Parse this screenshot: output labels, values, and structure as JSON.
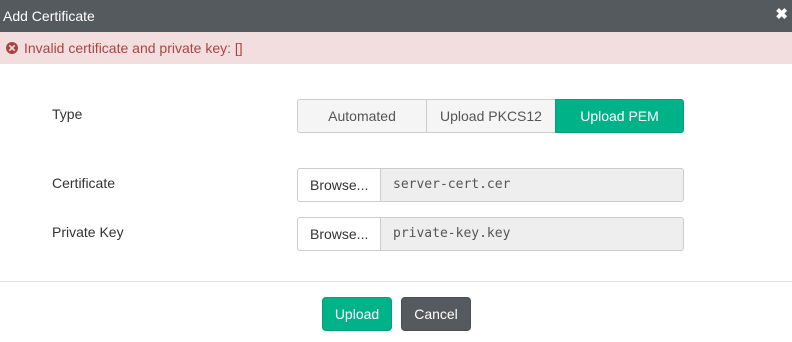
{
  "dialog": {
    "title": "Add Certificate",
    "close_icon": "close-icon",
    "close_glyph": "✖"
  },
  "alert": {
    "icon": "error-circle-icon",
    "message": "Invalid certificate and private key: []"
  },
  "form": {
    "type_label": "Type",
    "type_options": [
      "Automated",
      "Upload PKCS12",
      "Upload PEM"
    ],
    "type_selected": "Upload PEM",
    "certificate_label": "Certificate",
    "certificate_browse": "Browse...",
    "certificate_file": "server-cert.cer",
    "private_key_label": "Private Key",
    "private_key_browse": "Browse...",
    "private_key_file": "private-key.key"
  },
  "footer": {
    "upload_label": "Upload",
    "cancel_label": "Cancel"
  },
  "colors": {
    "titlebar": "#555a5e",
    "alert_bg": "#f2dede",
    "alert_text": "#a94442",
    "accent": "#00b287",
    "cancel": "#555a5e"
  }
}
